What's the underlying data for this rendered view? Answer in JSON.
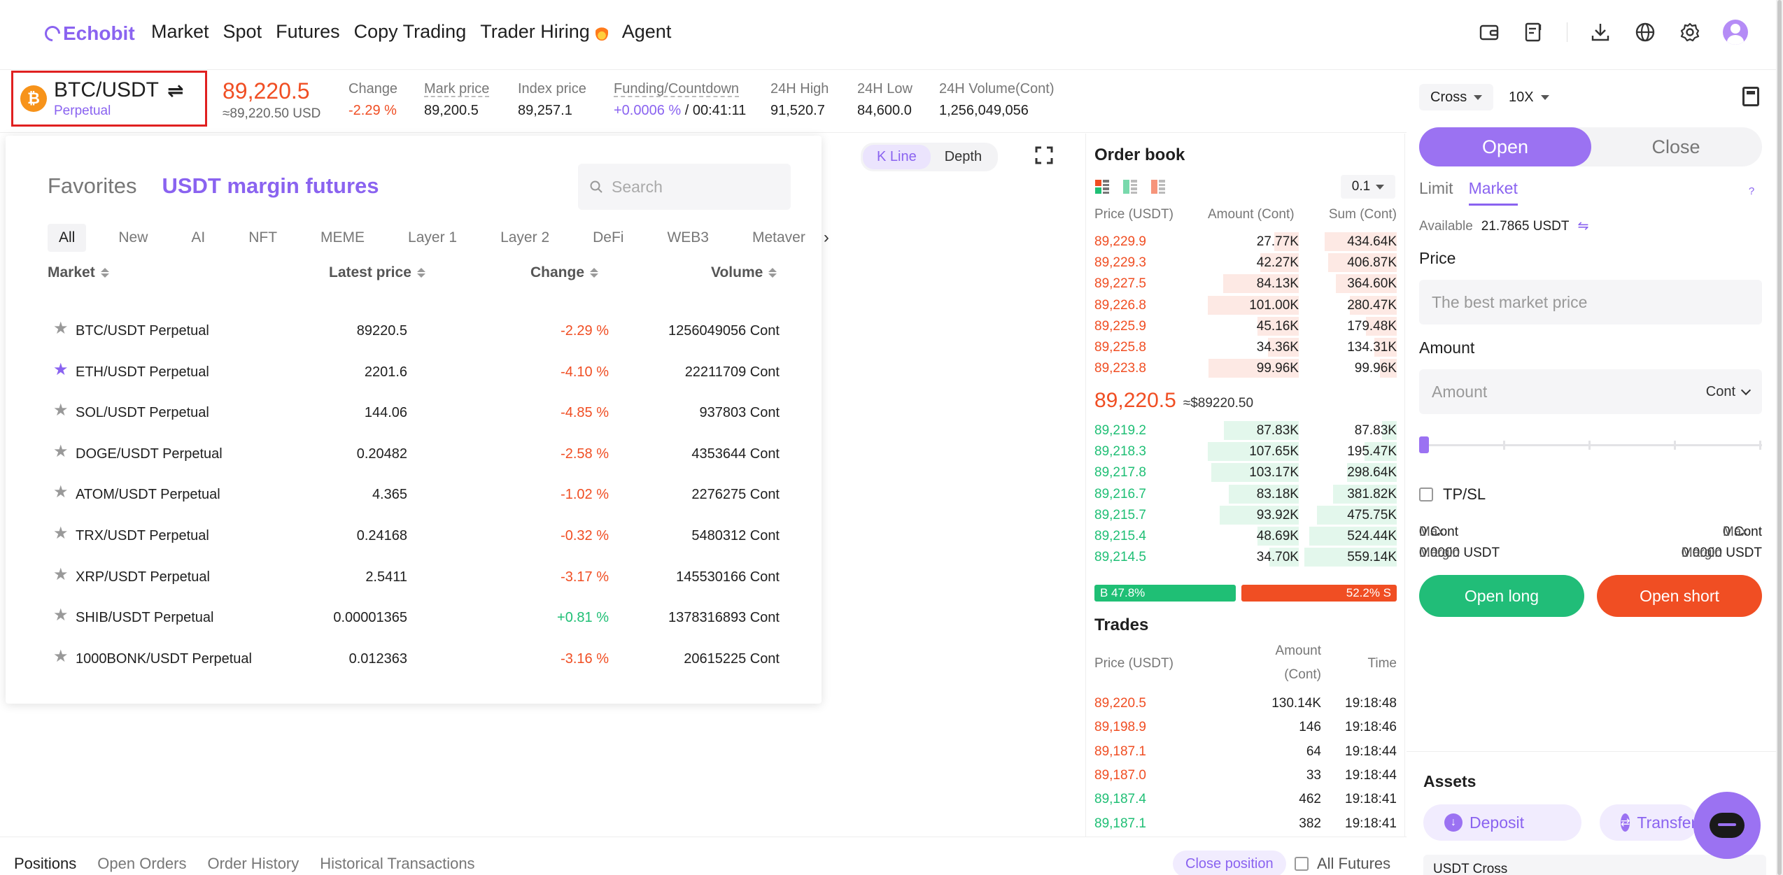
{
  "brand": {
    "name": "Echobit",
    "color": "#8a63f0"
  },
  "nav": {
    "items": [
      "Market",
      "Spot",
      "Futures",
      "Copy Trading",
      "Trader Hiring",
      "Agent"
    ],
    "icons": [
      "wallet-icon",
      "orders-icon",
      "download-icon",
      "globe-icon",
      "settings-icon",
      "avatar"
    ]
  },
  "ticker": {
    "pair": "BTC/USDT",
    "pair_type": "Perpetual",
    "last_price": "89,220.5",
    "last_usd": "≈89,220.50 USD",
    "stats": [
      {
        "label": "Change",
        "value": "-2.29 %"
      },
      {
        "label": "Mark price",
        "value": "89,200.5"
      },
      {
        "label": "Index price",
        "value": "89,257.1"
      },
      {
        "label": "Funding/Countdown",
        "value_a": "+0.0006 %",
        "value_b": "/ 00:41:11"
      },
      {
        "label": "24H High",
        "value": "91,520.7"
      },
      {
        "label": "24H Low",
        "value": "84,600.0"
      },
      {
        "label": "24H Volume(Cont)",
        "value": "1,256,049,056"
      }
    ]
  },
  "chart": {
    "tabs": [
      "K Line",
      "Depth"
    ],
    "active_tab": "K Line"
  },
  "market_dropdown": {
    "tabs": [
      "Favorites",
      "USDT margin futures"
    ],
    "active_tab": "USDT margin futures",
    "search_placeholder": "Search",
    "categories": [
      "All",
      "New",
      "AI",
      "NFT",
      "MEME",
      "Layer 1",
      "Layer 2",
      "DeFi",
      "WEB3",
      "Metaver"
    ],
    "active_category": "All",
    "columns": [
      "Market",
      "Latest price",
      "Change",
      "Volume"
    ],
    "rows": [
      {
        "name": "BTC/USDT Perpetual",
        "price": "89220.5",
        "change": "-2.29 %",
        "volume": "1256049056 Cont",
        "fav": false
      },
      {
        "name": "ETH/USDT Perpetual",
        "price": "2201.6",
        "change": "-4.10 %",
        "volume": "22211709 Cont",
        "fav": true
      },
      {
        "name": "SOL/USDT Perpetual",
        "price": "144.06",
        "change": "-4.85 %",
        "volume": "937803 Cont",
        "fav": false
      },
      {
        "name": "DOGE/USDT Perpetual",
        "price": "0.20482",
        "change": "-2.58 %",
        "volume": "4353644 Cont",
        "fav": false
      },
      {
        "name": "ATOM/USDT Perpetual",
        "price": "4.365",
        "change": "-1.02 %",
        "volume": "2276275 Cont",
        "fav": false
      },
      {
        "name": "TRX/USDT Perpetual",
        "price": "0.24168",
        "change": "-0.32 %",
        "volume": "5480312 Cont",
        "fav": false
      },
      {
        "name": "XRP/USDT Perpetual",
        "price": "2.5411",
        "change": "-3.17 %",
        "volume": "145530166 Cont",
        "fav": false
      },
      {
        "name": "SHIB/USDT Perpetual",
        "price": "0.00001365",
        "change": "+0.81 %",
        "volume": "1378316893 Cont",
        "fav": false
      },
      {
        "name": "1000BONK/USDT Perpetual",
        "price": "0.012363",
        "change": "-3.16 %",
        "volume": "20615225 Cont",
        "fav": false
      }
    ]
  },
  "orderbook": {
    "title": "Order book",
    "precision": "0.1",
    "headers": [
      "Price (USDT)",
      "Amount (Cont)",
      "Sum (Cont)"
    ],
    "asks": [
      {
        "price": "89,229.9",
        "amount": "27.77K",
        "sum": "434.64K",
        "amount_frac": 0.27,
        "sum_frac": 0.78
      },
      {
        "price": "89,229.3",
        "amount": "42.27K",
        "sum": "406.87K",
        "amount_frac": 0.42,
        "sum_frac": 0.74
      },
      {
        "price": "89,227.5",
        "amount": "84.13K",
        "sum": "364.60K",
        "amount_frac": 0.83,
        "sum_frac": 0.66
      },
      {
        "price": "89,226.8",
        "amount": "101.00K",
        "sum": "280.47K",
        "amount_frac": 1.0,
        "sum_frac": 0.51
      },
      {
        "price": "89,225.9",
        "amount": "45.16K",
        "sum": "179.48K",
        "amount_frac": 0.45,
        "sum_frac": 0.33
      },
      {
        "price": "89,225.8",
        "amount": "34.36K",
        "sum": "134.31K",
        "amount_frac": 0.34,
        "sum_frac": 0.24
      },
      {
        "price": "89,223.8",
        "amount": "99.96K",
        "sum": "99.96K",
        "amount_frac": 0.99,
        "sum_frac": 0.18
      }
    ],
    "mid_price": "89,220.5",
    "mid_usd": "≈$89220.50",
    "bids": [
      {
        "price": "89,219.2",
        "amount": "87.83K",
        "sum": "87.83K",
        "amount_frac": 0.82,
        "sum_frac": 0.16
      },
      {
        "price": "89,218.3",
        "amount": "107.65K",
        "sum": "195.47K",
        "amount_frac": 1.0,
        "sum_frac": 0.35
      },
      {
        "price": "89,217.8",
        "amount": "103.17K",
        "sum": "298.64K",
        "amount_frac": 0.96,
        "sum_frac": 0.54
      },
      {
        "price": "89,216.7",
        "amount": "83.18K",
        "sum": "381.82K",
        "amount_frac": 0.77,
        "sum_frac": 0.69
      },
      {
        "price": "89,215.7",
        "amount": "93.92K",
        "sum": "475.75K",
        "amount_frac": 0.87,
        "sum_frac": 0.86
      },
      {
        "price": "89,215.4",
        "amount": "48.69K",
        "sum": "524.44K",
        "amount_frac": 0.45,
        "sum_frac": 0.95
      },
      {
        "price": "89,214.5",
        "amount": "34.70K",
        "sum": "559.14K",
        "amount_frac": 0.32,
        "sum_frac": 1.0
      }
    ],
    "buy_ratio": "B 47.8%",
    "sell_ratio": "52.2% S",
    "buy_frac": 0.478
  },
  "trades": {
    "title": "Trades",
    "headers": [
      "Price (USDT)",
      "Amount",
      "(Cont)",
      "Time"
    ],
    "rows": [
      {
        "price": "89,220.5",
        "amount": "130.14K",
        "time": "19:18:48",
        "side": "sell"
      },
      {
        "price": "89,198.9",
        "amount": "146",
        "time": "19:18:46",
        "side": "sell"
      },
      {
        "price": "89,187.1",
        "amount": "64",
        "time": "19:18:44",
        "side": "sell"
      },
      {
        "price": "89,187.0",
        "amount": "33",
        "time": "19:18:44",
        "side": "sell"
      },
      {
        "price": "89,187.4",
        "amount": "462",
        "time": "19:18:41",
        "side": "buy"
      },
      {
        "price": "89,187.1",
        "amount": "382",
        "time": "19:18:41",
        "side": "buy"
      }
    ]
  },
  "panel": {
    "margin_mode": "Cross",
    "leverage": "10X",
    "open_label": "Open",
    "close_label": "Close",
    "order_types": [
      "Limit",
      "Market"
    ],
    "active_order_type": "Market",
    "help": "?",
    "available_label": "Available",
    "available_value": "21.7865 USDT",
    "price_label": "Price",
    "price_placeholder": "The best market price",
    "amount_label": "Amount",
    "amount_placeholder": "Amount",
    "amount_unit": "Cont",
    "slider_level": 0,
    "tpsl_label": "TP/SL",
    "max_left_label": "Max",
    "max_left_value": "0 Cont",
    "max_right_label": "Max",
    "max_right_value": "0 Cont",
    "margin_left_label": "Margin",
    "margin_left_value": "0.0000 USDT",
    "margin_right_label": "Margin",
    "margin_right_value": "0.0000 USDT",
    "open_long": "Open long",
    "open_short": "Open short",
    "assets_title": "Assets",
    "deposit": "Deposit",
    "transfer": "Transfer",
    "usdt_cross": "USDT Cross"
  },
  "bottom": {
    "tabs": [
      "Positions",
      "Open Orders",
      "Order History",
      "Historical Transactions"
    ],
    "active_tab": "Positions",
    "close_position": "Close position",
    "all_futures": "All Futures"
  },
  "colors": {
    "up": "#1fbf75",
    "down": "#f04e23",
    "accent": "#8a63f0"
  }
}
